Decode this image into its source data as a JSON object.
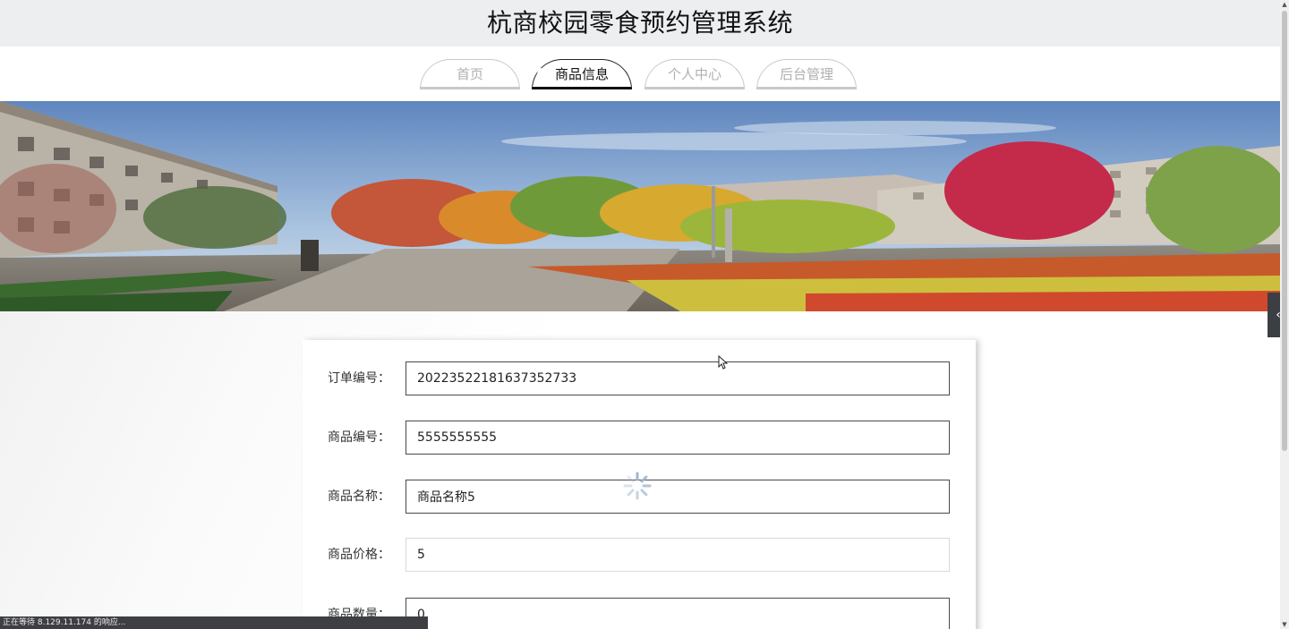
{
  "header": {
    "title": "杭商校园零食预约管理系统"
  },
  "nav": {
    "tabs": [
      {
        "label": "首页",
        "active": false
      },
      {
        "label": "商品信息",
        "active": true
      },
      {
        "label": "个人中心",
        "active": false
      },
      {
        "label": "后台管理",
        "active": false
      }
    ]
  },
  "form": {
    "fields": [
      {
        "label": "订单编号：",
        "value": "20223522181637352733"
      },
      {
        "label": "商品编号：",
        "value": "5555555555"
      },
      {
        "label": "商品名称：",
        "value": "商品名称5"
      },
      {
        "label": "商品价格：",
        "value": "5"
      },
      {
        "label": "商品数量：",
        "value": "0"
      }
    ]
  },
  "side_toggle": {
    "icon": "chevron-left-icon",
    "glyph": "‹"
  },
  "status_bar": {
    "text": "正在等待 8.129.11.174 的响应..."
  },
  "colors": {
    "header_bg": "#eceef0",
    "active_tab_border": "#111111",
    "inactive_tab_text": "#b0b0b0",
    "status_bar_bg": "#3d3f42"
  }
}
